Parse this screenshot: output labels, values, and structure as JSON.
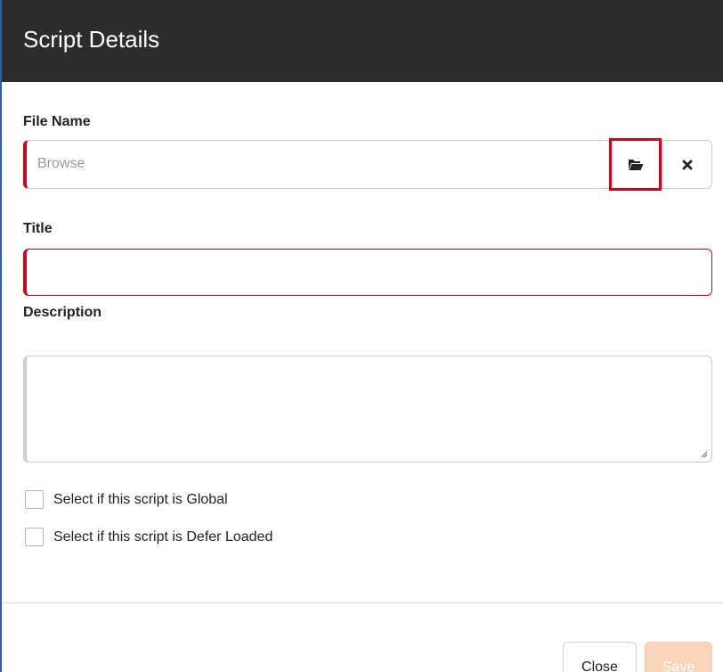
{
  "dialog": {
    "title": "Script Details"
  },
  "fields": {
    "file_name": {
      "label": "File Name",
      "placeholder": "Browse",
      "browse_icon": "folder-open-icon",
      "clear_icon": "close-icon"
    },
    "title": {
      "label": "Title",
      "value": ""
    },
    "description": {
      "label": "Description",
      "value": ""
    }
  },
  "options": [
    {
      "label": "Select if this script is Global",
      "checked": false
    },
    {
      "label": "Select if this script is Defer Loaded",
      "checked": false
    }
  ],
  "footer": {
    "close_label": "Close",
    "save_label": "Save"
  },
  "colors": {
    "header_bg": "#2c2c2c",
    "required_accent": "#d0021b",
    "save_disabled_bg": "#f9d5bb"
  }
}
